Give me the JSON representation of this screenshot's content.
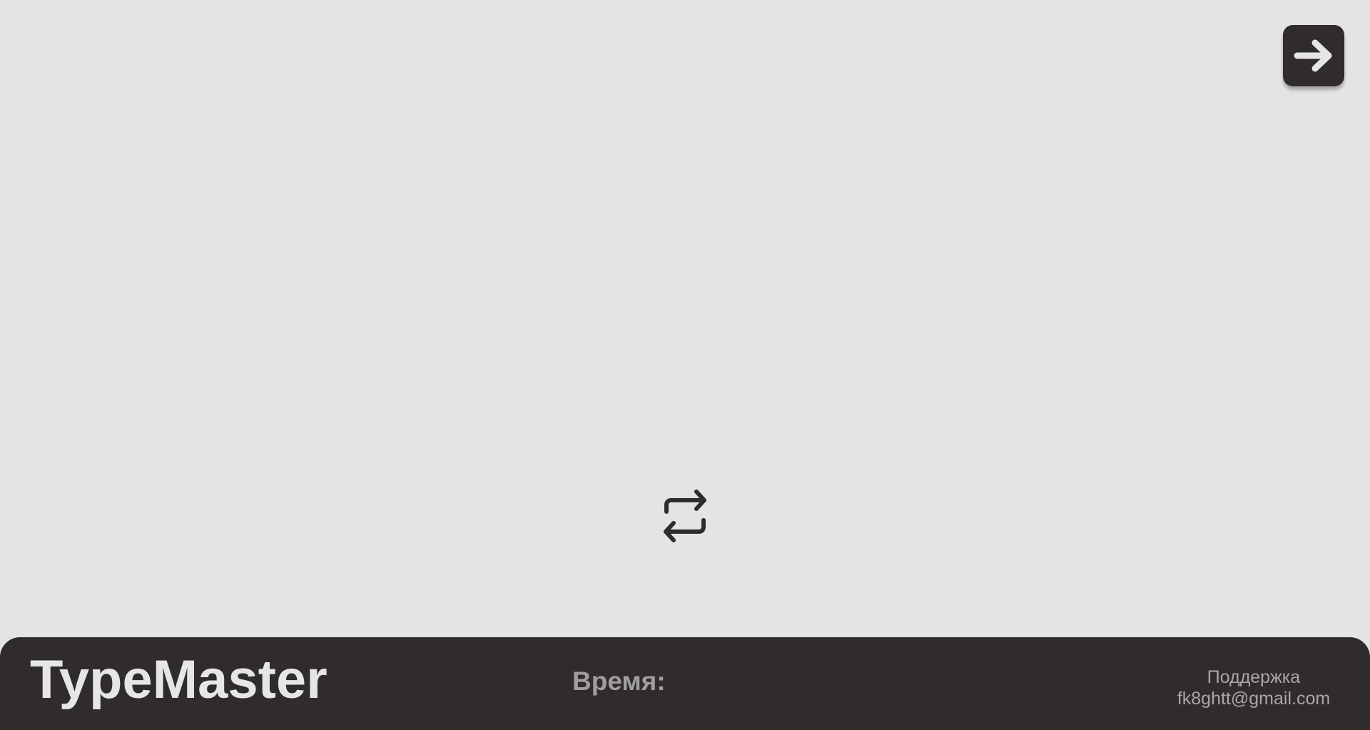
{
  "app": {
    "background_color": "#e4e4e4",
    "panel_color": "#302c2c"
  },
  "toolbar": {
    "next_icon": "arrow-right-icon",
    "swap_icon": "repeat-swap-icon"
  },
  "footer": {
    "brand": "TypeMaster",
    "time_label": "Время:",
    "time_value": "",
    "support_label": "Поддержка",
    "support_email": "fk8ghtt@gmail.com"
  }
}
